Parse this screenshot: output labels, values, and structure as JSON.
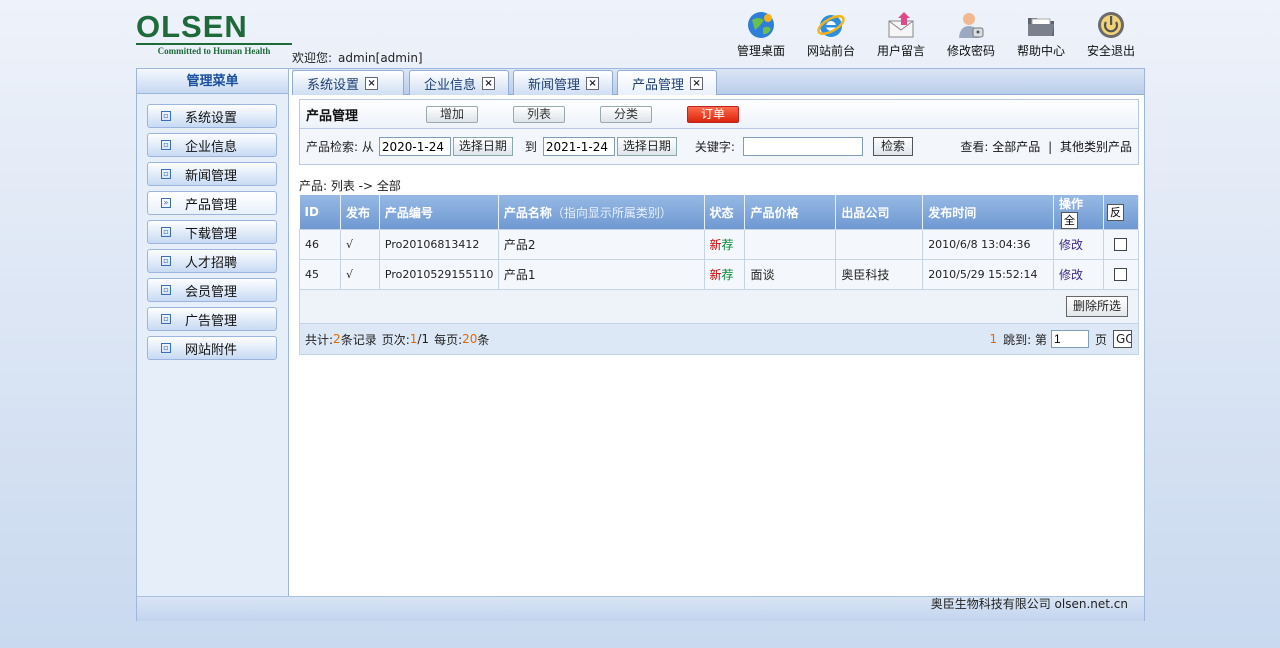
{
  "logo": {
    "text": "OLSEN",
    "tagline": "Committed to Human Health"
  },
  "welcome": {
    "label": "欢迎您:",
    "user": "admin[admin]"
  },
  "topnav": [
    {
      "label": "管理桌面",
      "icon": "globe-icon"
    },
    {
      "label": "网站前台",
      "icon": "ie-icon"
    },
    {
      "label": "用户留言",
      "icon": "mail-icon"
    },
    {
      "label": "修改密码",
      "icon": "user-key-icon"
    },
    {
      "label": "帮助中心",
      "icon": "folder-icon"
    },
    {
      "label": "安全退出",
      "icon": "power-icon"
    }
  ],
  "sidebar": {
    "title": "管理菜单",
    "items": [
      {
        "label": "系统设置"
      },
      {
        "label": "企业信息"
      },
      {
        "label": "新闻管理"
      },
      {
        "label": "产品管理"
      },
      {
        "label": "下载管理"
      },
      {
        "label": "人才招聘"
      },
      {
        "label": "会员管理"
      },
      {
        "label": "广告管理"
      },
      {
        "label": "网站附件"
      }
    ]
  },
  "tabs": [
    {
      "label": "系统设置",
      "close": "×"
    },
    {
      "label": "企业信息",
      "close": "×"
    },
    {
      "label": "新闻管理",
      "close": "×"
    },
    {
      "label": "产品管理",
      "close": "×"
    }
  ],
  "toolbar": {
    "title": "产品管理",
    "add": "增加",
    "list": "列表",
    "category": "分类",
    "order": "订单"
  },
  "search": {
    "label": "产品检索: 从",
    "from": "2020-1-24",
    "pick_date": "选择日期",
    "to_label": "到",
    "to": "2021-1-24",
    "keyword_label": "关键字:",
    "keyword": "",
    "search_btn": "检索",
    "view_label": "查看:",
    "view_all": "全部产品",
    "sep": "|",
    "view_other": "其他类别产品"
  },
  "crumb": "产品: 列表 -> 全部",
  "table": {
    "headers": {
      "id": "ID",
      "publish": "发布",
      "code": "产品编号",
      "name": "产品名称",
      "name_note": "（指向显示所属类别）",
      "status": "状态",
      "price": "产品价格",
      "company": "出品公司",
      "time": "发布时间",
      "ops": "操作",
      "select_all": "全",
      "invert": "反"
    },
    "rows": [
      {
        "id": "46",
        "publish": "√",
        "code": "Pro20106813412",
        "name": "产品2",
        "status_new": "新",
        "status_rec": "荐",
        "price": "",
        "company": "",
        "time": "2010/6/8 13:04:36",
        "edit": "修改"
      },
      {
        "id": "45",
        "publish": "√",
        "code": "Pro2010529155110",
        "name": "产品1",
        "status_new": "新",
        "status_rec": "荐",
        "price": "面谈",
        "company": "奥臣科技",
        "time": "2010/5/29 15:52:14",
        "edit": "修改"
      }
    ],
    "delete_selected": "删除所选"
  },
  "pager": {
    "total_label": "共计:",
    "total": "2",
    "records": "条记录",
    "page_label": "页次:",
    "page": "1",
    "pages": "/1",
    "per_label": "每页:",
    "per": "20",
    "per_unit": "条",
    "current": "1",
    "jump_label": "跳到: 第",
    "jump_value": "1",
    "page_unit": "页",
    "go": "GO"
  },
  "footer": {
    "copyright": "奥臣生物科技有限公司 olsen.net.cn"
  },
  "colors": {
    "brand_green": "#1e6a3a",
    "header_blue": "#6f99d2",
    "accent_red": "#d9250c"
  }
}
